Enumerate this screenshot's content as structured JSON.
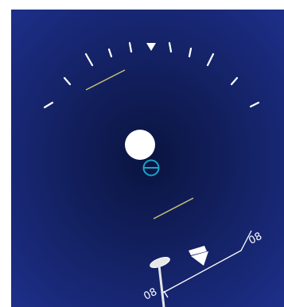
{
  "colors": {
    "background_top": "#1d2f8a",
    "background_center": "#0a1440",
    "marker": "#ffffff",
    "pitch_line": "#c9c07a",
    "flight_path": "#1aa3c8"
  },
  "tape": {
    "left_label": "08",
    "right_label": "08"
  },
  "icons": {
    "roll_pointer": "roll-pointer-icon",
    "sun": "sun-icon",
    "flight_path_marker": "flight-path-marker-icon",
    "heading_bug": "heading-bug-icon",
    "aircraft_symbol": "aircraft-symbol-icon"
  }
}
